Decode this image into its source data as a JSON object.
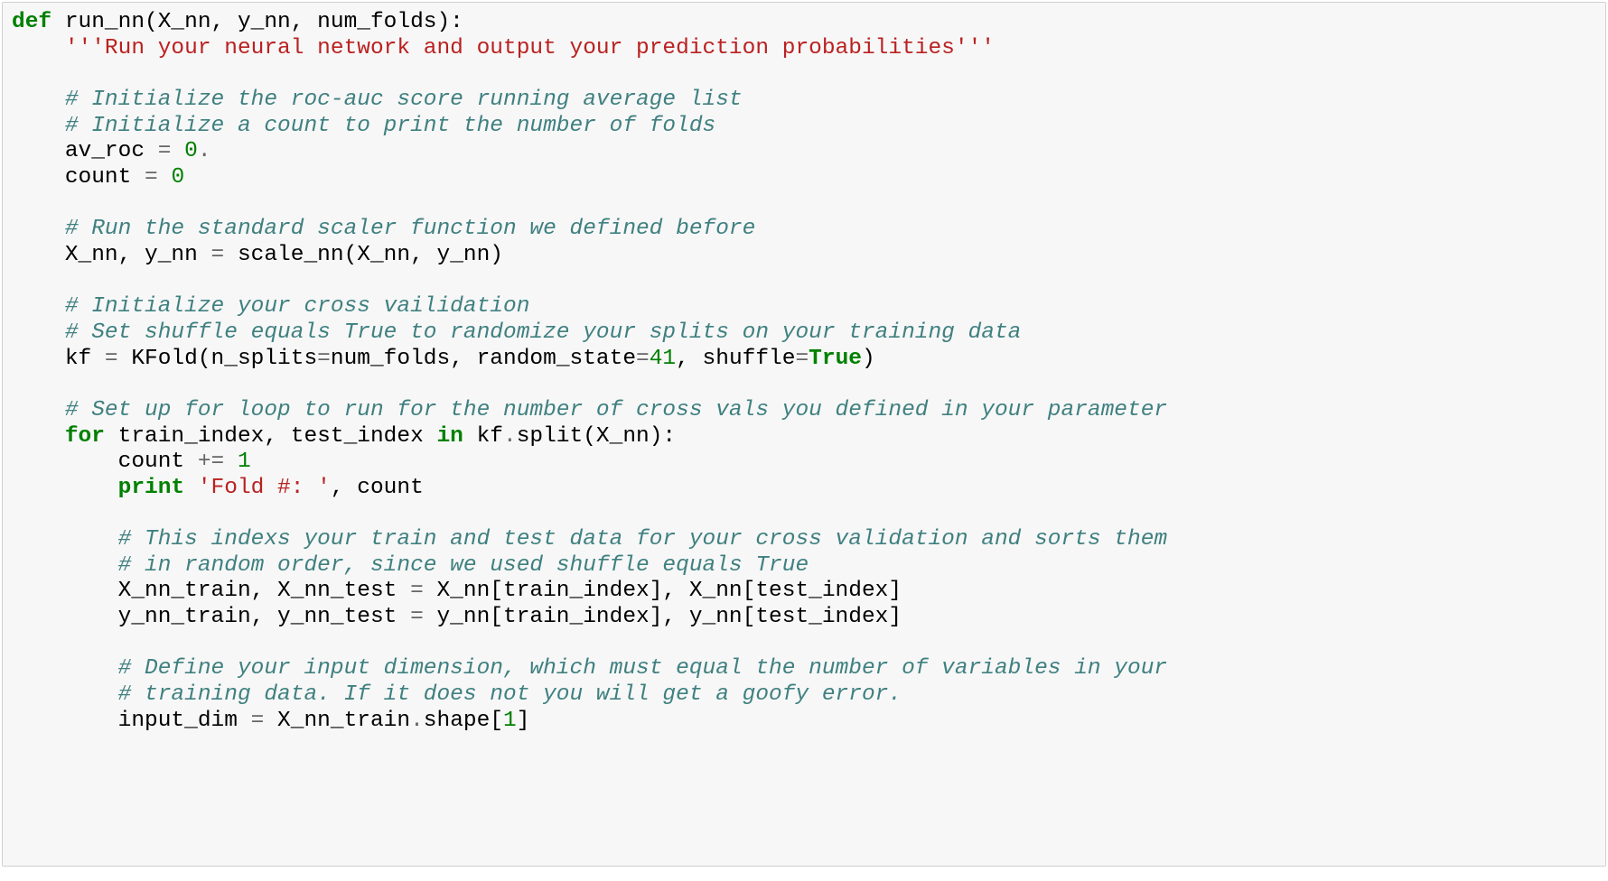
{
  "code": {
    "l1_kw": "def ",
    "l1_fn": "run_nn(X_nn, y_nn, num_folds):",
    "l2_str": "'''Run your neural network and output your prediction probabilities'''",
    "l4_c": "# Initialize the roc-auc score running average list",
    "l5_c": "# Initialize a count to print the number of folds",
    "l6_a": "av_roc ",
    "l6_op": "=",
    "l6_b": " ",
    "l6_n1": "0",
    "l6_dot": ".",
    "l7_a": "count ",
    "l7_op": "=",
    "l7_b": " ",
    "l7_n": "0",
    "l9_c": "# Run the standard scaler function we defined before",
    "l10": "X_nn, y_nn ",
    "l10_op": "=",
    "l10_b": " scale_nn(X_nn, y_nn)",
    "l12_c": "# Initialize your cross vailidation",
    "l13_c": "# Set shuffle equals True to randomize your splits on your training data",
    "l14_a": "kf ",
    "l14_op": "=",
    "l14_b": " KFold(n_splits",
    "l14_op2": "=",
    "l14_c2": "num_folds, random_state",
    "l14_op3": "=",
    "l14_n": "41",
    "l14_d": ", shuffle",
    "l14_op4": "=",
    "l14_kw": "True",
    "l14_e": ")",
    "l16_c": "# Set up for loop to run for the number of cross vals you defined in your parameter",
    "l17_kw1": "for",
    "l17_a": " train_index, test_index ",
    "l17_kw2": "in",
    "l17_b": " kf",
    "l17_dot": ".",
    "l17_c2": "split(X_nn):",
    "l18_a": "count ",
    "l18_op": "+=",
    "l18_b": " ",
    "l18_n": "1",
    "l19_kw": "print",
    "l19_a": " ",
    "l19_s": "'Fold #: '",
    "l19_b": ", count",
    "l21_c": "# This indexs your train and test data for your cross validation and sorts them",
    "l22_c": "# in random order, since we used shuffle equals True",
    "l23_a": "X_nn_train, X_nn_test ",
    "l23_op": "=",
    "l23_b": " X_nn[train_index], X_nn[test_index]",
    "l24_a": "y_nn_train, y_nn_test ",
    "l24_op": "=",
    "l24_b": " y_nn[train_index], y_nn[test_index]",
    "l26_c": "# Define your input dimension, which must equal the number of variables in your",
    "l27_c": "# training data. If it does not you will get a goofy error.",
    "l28_a": "input_dim ",
    "l28_op": "=",
    "l28_b": " X_nn_train",
    "l28_dot": ".",
    "l28_c2": "shape[",
    "l28_n": "1",
    "l28_d": "]"
  }
}
